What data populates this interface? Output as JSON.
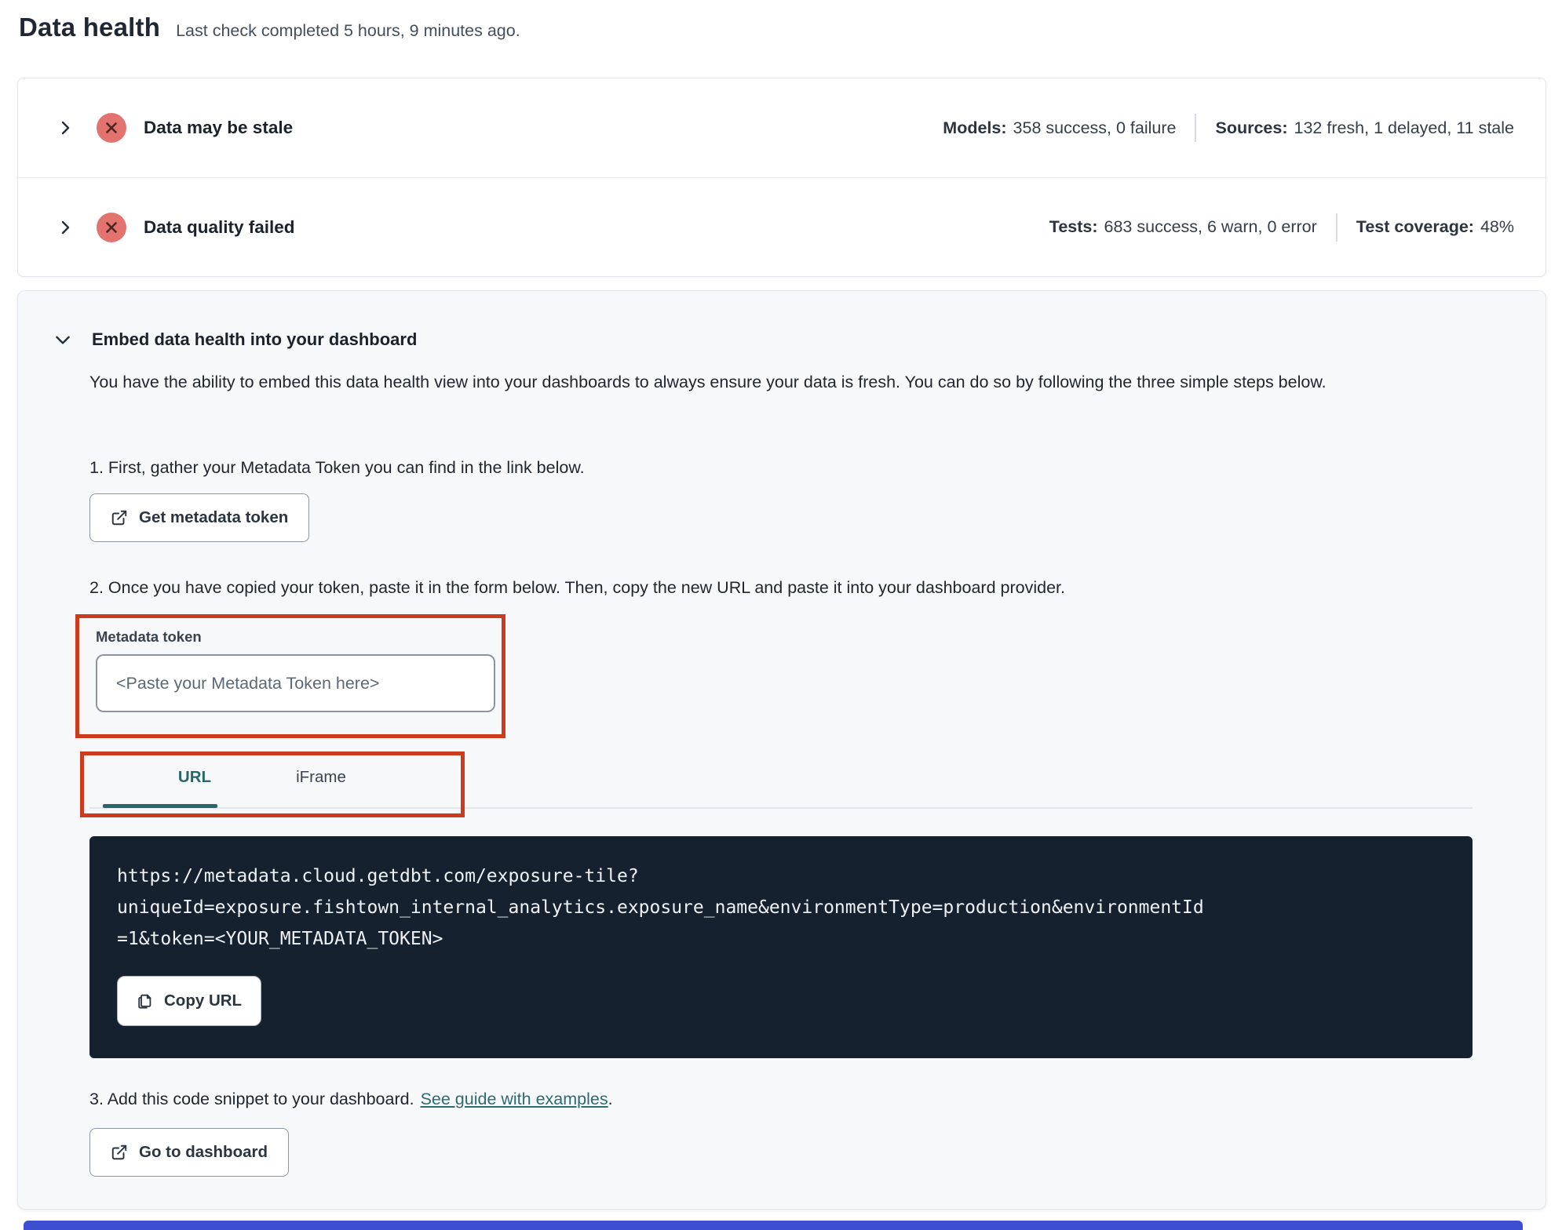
{
  "page": {
    "title": "Data health",
    "subtitle": "Last check completed 5 hours, 9 minutes ago."
  },
  "status_rows": [
    {
      "title": "Data may be stale",
      "status_icon": "error-x-circle",
      "stats": [
        {
          "label": "Models:",
          "value": "358 success, 0 failure"
        },
        {
          "label": "Sources:",
          "value": "132 fresh, 1 delayed, 11 stale"
        }
      ]
    },
    {
      "title": "Data quality failed",
      "status_icon": "error-x-circle",
      "stats": [
        {
          "label": "Tests:",
          "value": "683 success, 6 warn, 0 error"
        },
        {
          "label": "Test coverage:",
          "value": "48%"
        }
      ]
    }
  ],
  "embed": {
    "title": "Embed data health into your dashboard",
    "description": "You have the ability to embed this data health view into your dashboards to always ensure your data is fresh. You can do so by following the three simple steps below.",
    "steps": {
      "step1": "1. First, gather your Metadata Token you can find in the link below.",
      "step2": "2. Once you have copied your token, paste it in the form below. Then, copy the new URL and paste it into your dashboard provider.",
      "step3_text": "3. Add this code snippet to your dashboard.",
      "step3_link": "See guide with examples",
      "step3_period": "."
    },
    "buttons": {
      "get_token": "Get metadata token",
      "copy_url": "Copy URL",
      "go_dashboard": "Go to dashboard"
    },
    "token_field": {
      "label": "Metadata token",
      "placeholder": "<Paste your Metadata Token here>",
      "value": ""
    },
    "tabs": [
      {
        "label": "URL",
        "active": true
      },
      {
        "label": "iFrame",
        "active": false
      }
    ],
    "code": {
      "url": "https://metadata.cloud.getdbt.com/exposure-tile?uniqueId=exposure.fishtown_internal_analytics.exposure_name&environmentType=production&environmentId=1&token=<YOUR_METADATA_TOKEN>",
      "lines": [
        "https://metadata.cloud.getdbt.com/exposure-tile?",
        "uniqueId=exposure.fishtown_internal_analytics.exposure_name&environmentType=production&environmentId",
        "=1&token=<YOUR_METADATA_TOKEN>"
      ]
    }
  },
  "icons": {
    "chevron_right": "›",
    "chevron_down": "⌄",
    "error_x": "✕",
    "external_link": "↗",
    "copy": "⧉"
  },
  "colors": {
    "annotation_red": "#cd3b1e",
    "error_icon_bg": "#e3736e",
    "error_icon_glyph": "#4a2522",
    "teal_accent": "#29666b",
    "code_block_bg": "#16212f",
    "bottom_bar_blue": "#3e4ed0",
    "embed_card_bg": "#f7f8f9"
  }
}
